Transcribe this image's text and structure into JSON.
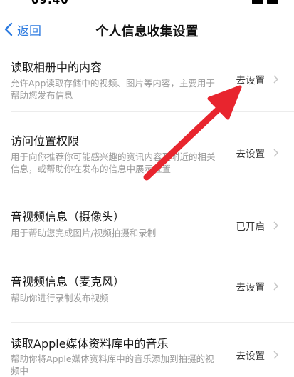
{
  "nav": {
    "back_label": "返回",
    "title": "个人信息收集设置"
  },
  "rows": [
    {
      "title": "读取相册中的内容",
      "description": "允许App读取存储中的视频、图片等内容，主要用于帮助您发布信息",
      "action": "去设置"
    },
    {
      "title": "访问位置权限",
      "description": "用于向你推荐你可能感兴趣的资讯内容及附近的相关信息，或帮助你在发布的信息中展示位置",
      "action": "去设置"
    },
    {
      "title": "音视频信息（摄像头）",
      "description": "用于帮助您完成图片/视频拍摄和录制",
      "action": "已开启"
    },
    {
      "title": "音视频信息（麦克风）",
      "description": "帮助你进行录制发布视频",
      "action": "去设置"
    },
    {
      "title": "读取Apple媒体资料库中的音乐",
      "description": "帮助你将Apple媒体资料库中的音乐添加到拍摄的视频中",
      "action": "去设置"
    }
  ],
  "colors": {
    "accent": "#2d7be0",
    "annotation": "#e8252e"
  }
}
